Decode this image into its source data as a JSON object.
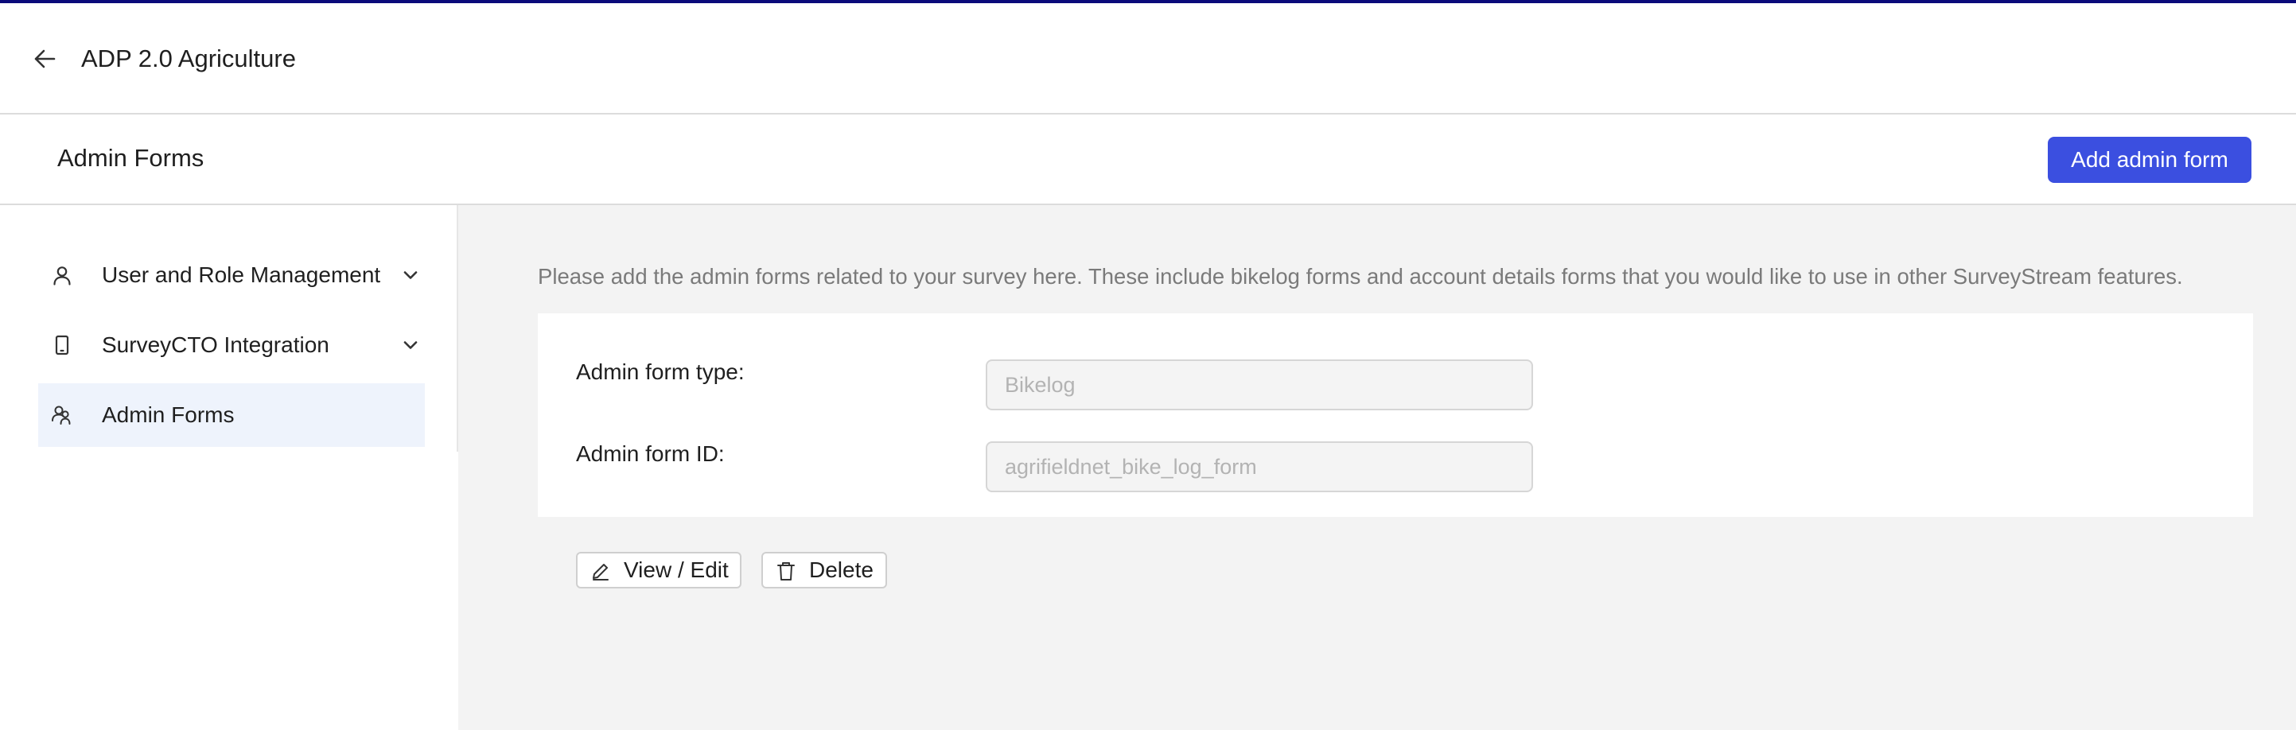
{
  "app": {
    "title": "ADP 2.0 Agriculture",
    "accent_color": "#0a0a7a"
  },
  "header": {
    "back_icon": "arrow-left-icon",
    "page_title": "Admin Forms",
    "add_button_label": "Add admin form",
    "add_button_color": "#3b4fe0"
  },
  "sidebar": {
    "items": [
      {
        "label": "User and Role Management",
        "icon": "user-icon",
        "expandable": true,
        "active": false
      },
      {
        "label": "SurveyCTO Integration",
        "icon": "mobile-phone-icon",
        "expandable": true,
        "active": false
      },
      {
        "label": "Admin Forms",
        "icon": "users-icon",
        "expandable": false,
        "active": true
      }
    ]
  },
  "main": {
    "description": "Please add the admin forms related to your survey here. These include bikelog forms and account details forms that you would like to use in other SurveyStream features.",
    "form_card": {
      "type_label": "Admin form type:",
      "type_value": "Bikelog",
      "id_label": "Admin form ID:",
      "id_value": "agrifieldnet_bike_log_form",
      "view_edit_label": "View / Edit",
      "delete_label": "Delete"
    }
  }
}
